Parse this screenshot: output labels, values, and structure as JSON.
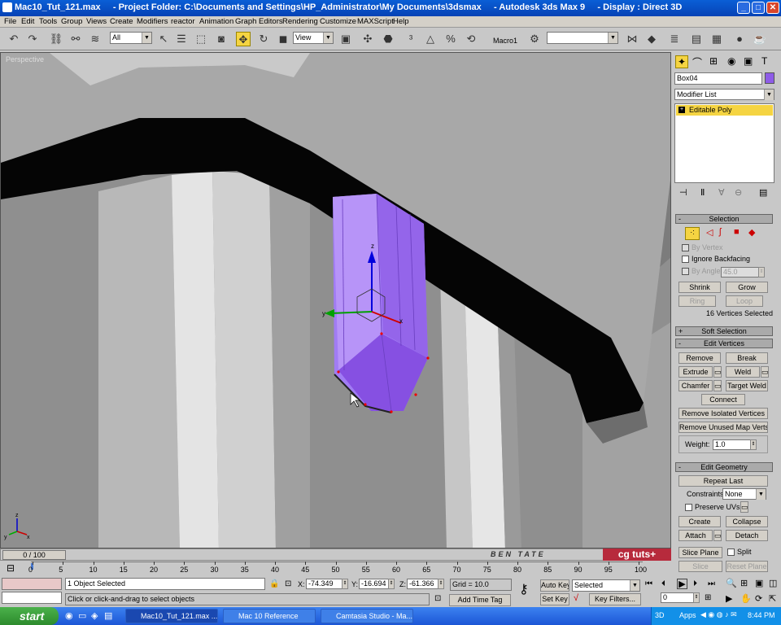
{
  "window": {
    "title": "Mac10_Tut_121.max     - Project Folder: C:\\Documents and Settings\\HP_Administrator\\My Documents\\3dsmax     - Autodesk 3ds Max 9     - Display : Direct 3D",
    "minimize_label": "_",
    "maximize_label": "□",
    "close_label": "✕"
  },
  "menu": [
    "File",
    "Edit",
    "Tools",
    "Group",
    "Views",
    "Create",
    "Modifiers",
    "reactor",
    "Animation",
    "Graph Editors",
    "Rendering",
    "Customize",
    "MAXScript",
    "Help"
  ],
  "toolbar": {
    "selection_filter": "All",
    "ref_coord": "View",
    "macro_label": "Macro1",
    "named_selection": ""
  },
  "viewport": {
    "label": "Perspective",
    "watermark_name": "BEN   TATE",
    "watermark_logo": "cg tuts+"
  },
  "command_panel": {
    "object_name": "Box04",
    "object_color": "#8e5ce8",
    "modifier_list": "Modifier List",
    "stack_item": "Editable Poly",
    "selection": {
      "header": "Selection",
      "by_vertex": "By Vertex",
      "ignore_backfacing": "Ignore Backfacing",
      "by_angle": "By Angle:",
      "angle_value": "45.0",
      "shrink": "Shrink",
      "grow": "Grow",
      "ring": "Ring",
      "loop": "Loop",
      "status": "16 Vertices Selected"
    },
    "soft_selection": {
      "header": "Soft Selection"
    },
    "edit_vertices": {
      "header": "Edit Vertices",
      "remove": "Remove",
      "break": "Break",
      "extrude": "Extrude",
      "weld": "Weld",
      "chamfer": "Chamfer",
      "target_weld": "Target Weld",
      "connect": "Connect",
      "remove_isolated": "Remove Isolated Vertices",
      "remove_unused": "Remove Unused Map Verts",
      "weight_label": "Weight:",
      "weight_value": "1.0"
    },
    "edit_geometry": {
      "header": "Edit Geometry",
      "repeat_last": "Repeat Last",
      "constraints_label": "Constraints:",
      "constraints_value": "None",
      "preserve_uvs": "Preserve UVs",
      "create": "Create",
      "collapse": "Collapse",
      "attach": "Attach",
      "detach": "Detach",
      "slice_plane": "Slice Plane",
      "split": "Split",
      "slice": "Slice",
      "reset_plane": "Reset Plane"
    }
  },
  "timeline": {
    "slider_label": "0 / 100",
    "ticks": [
      "0",
      "5",
      "10",
      "15",
      "20",
      "25",
      "30",
      "35",
      "40",
      "45",
      "50",
      "55",
      "60",
      "65",
      "70",
      "75",
      "80",
      "85",
      "90",
      "95",
      "100"
    ]
  },
  "status": {
    "selection_info": "1 Object Selected",
    "prompt": "Click or click-and-drag to select objects",
    "x_label": "X:",
    "x_value": "-74.349",
    "y_label": "Y:",
    "y_value": "-16.694",
    "z_label": "Z:",
    "z_value": "-61.366",
    "grid": "Grid = 10.0",
    "add_time_tag": "Add Time Tag",
    "auto_key": "Auto Key",
    "set_key": "Set Key",
    "key_mode": "Selected",
    "key_filters": "Key Filters...",
    "frame": "0"
  },
  "taskbar": {
    "start": "start",
    "tasks": [
      "Mac10_Tut_121.max ...",
      "Mac 10 Reference",
      "Camtasia Studio - Ma..."
    ],
    "tray_3d": "3D",
    "tray_apps": "Apps",
    "clock": "8:44 PM"
  }
}
